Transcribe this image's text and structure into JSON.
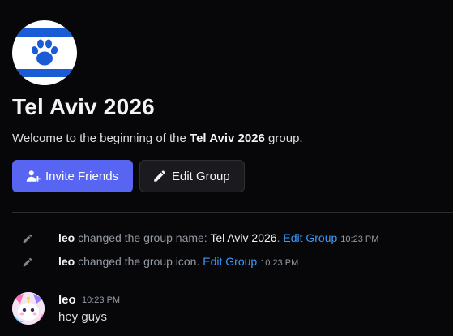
{
  "group": {
    "title": "Tel Aviv 2026",
    "icon": "paw-icon",
    "welcome_prefix": "Welcome to the beginning of the ",
    "welcome_name": "Tel Aviv 2026",
    "welcome_suffix": " group."
  },
  "buttons": {
    "invite_label": "Invite Friends",
    "invite_icon": "add-friend-icon",
    "edit_label": "Edit Group",
    "edit_icon": "pencil-icon"
  },
  "system_messages": [
    {
      "author": "leo",
      "action": " changed the group name: ",
      "detail": "Tel Aviv 2026",
      "after": ". ",
      "link": "Edit Group",
      "time": "10:23 PM"
    },
    {
      "author": "leo",
      "action": " changed the group icon. ",
      "link": "Edit Group",
      "time": "10:23 PM"
    }
  ],
  "message": {
    "author": "leo",
    "time": "10:23 PM",
    "text": "hey guys"
  },
  "colors": {
    "background": "#070709",
    "accent": "#5865f2",
    "link": "#3a9bff",
    "icon_blue": "#1a5bd6"
  }
}
